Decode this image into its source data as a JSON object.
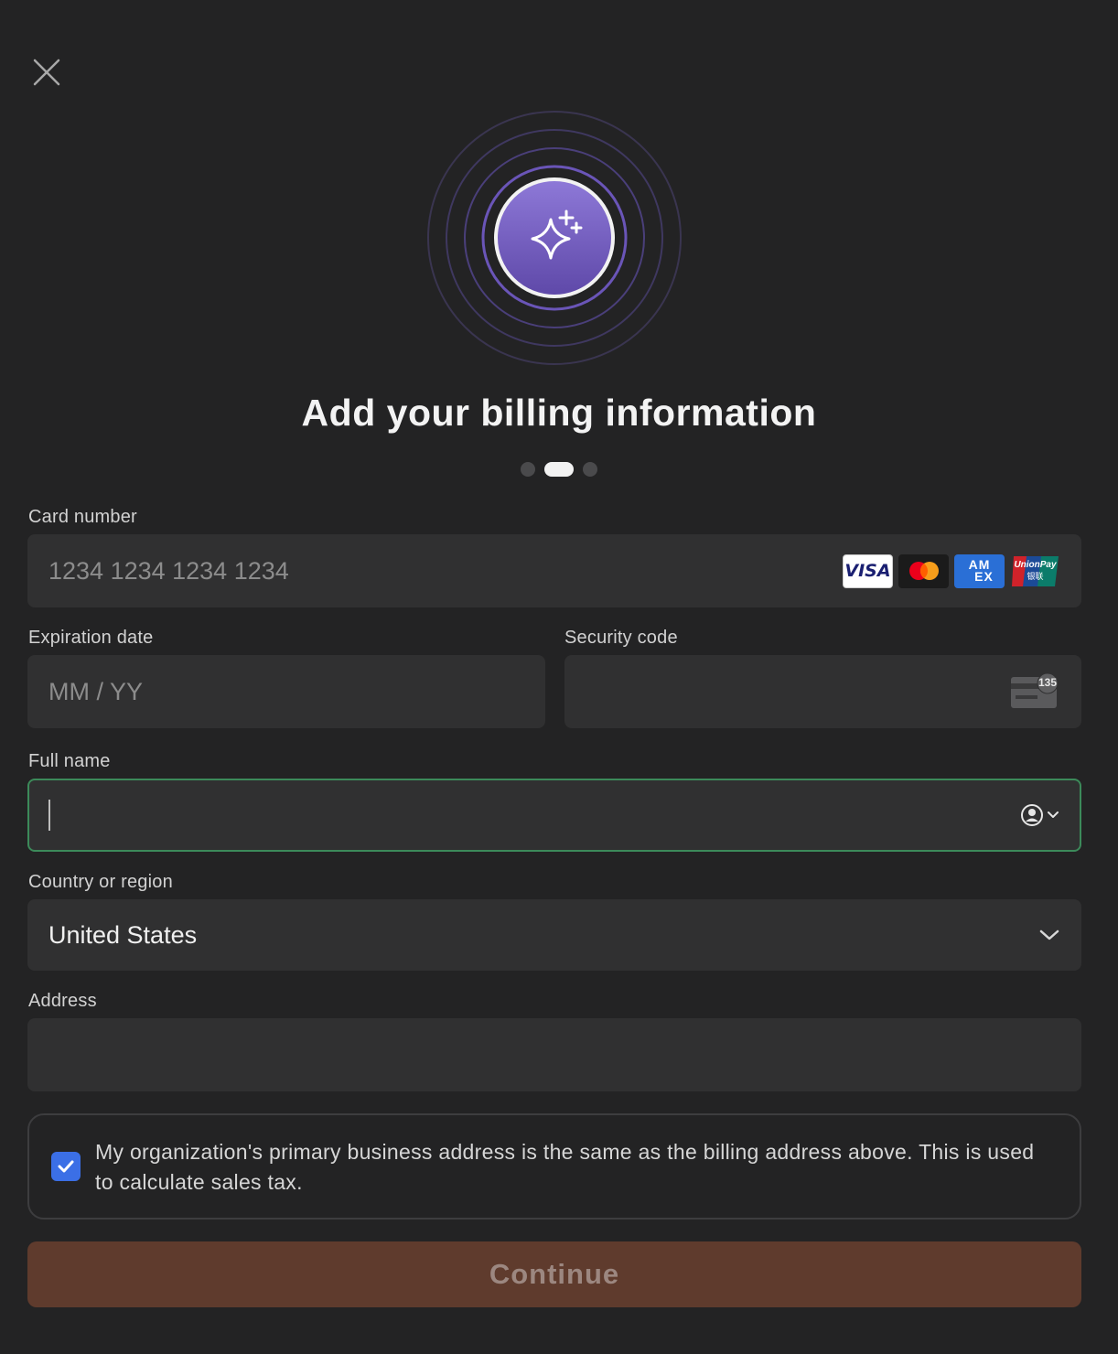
{
  "header": {
    "close_icon": "close-icon",
    "hero_icon": "sparkles-icon",
    "title": "Add your billing information",
    "step_indicator": {
      "total": 3,
      "current": 2
    }
  },
  "form": {
    "card_number": {
      "label": "Card number",
      "placeholder": "1234 1234 1234 1234",
      "brands": {
        "visa": "VISA",
        "mastercard_icon": "mastercard-icon",
        "amex_line1": "AM",
        "amex_line2": "EX",
        "unionpay_line1": "UnionPay",
        "unionpay_line2": "银联"
      }
    },
    "expiration": {
      "label": "Expiration date",
      "placeholder": "MM / YY"
    },
    "security_code": {
      "label": "Security code",
      "placeholder": "",
      "hint_number": "135"
    },
    "full_name": {
      "label": "Full name",
      "value": "",
      "autofill_icon": "person-circle-chevron-icon"
    },
    "country": {
      "label": "Country or region",
      "value": "United States"
    },
    "address": {
      "label": "Address",
      "value": ""
    },
    "same_address": {
      "checked": true,
      "text": "My organization's primary business address is the same as the billing address above. This is used to calculate sales tax."
    }
  },
  "actions": {
    "continue_label": "Continue"
  },
  "colors": {
    "background": "#232324",
    "field_bg": "#303031",
    "focus_border": "#3c8a5a",
    "checkbox": "#3b6fe6",
    "continue_bg": "#5f3b2d",
    "hero_purple": "#7b62c4"
  }
}
